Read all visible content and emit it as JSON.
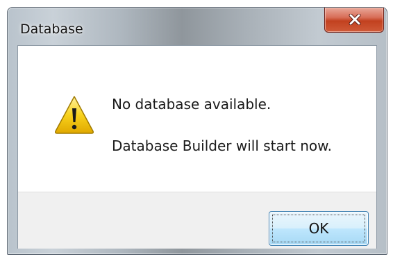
{
  "window": {
    "title": "Database"
  },
  "message": {
    "line1": "No database available.",
    "line2": "Database Builder will start now.",
    "icon": "warning-icon"
  },
  "buttons": {
    "ok_label": "OK",
    "close_icon": "close-icon"
  },
  "colors": {
    "close_red": "#c2411f",
    "button_blue": "#3c7fb1",
    "warning_yellow": "#f5c400"
  }
}
